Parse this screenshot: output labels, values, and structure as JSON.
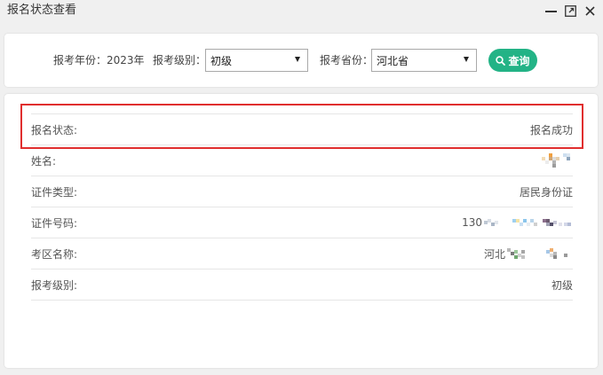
{
  "window": {
    "title": "报名状态查看",
    "controls": {
      "minimize_icon": "minimize-icon",
      "maximize_icon": "maximize-icon",
      "close_icon": "close-icon"
    }
  },
  "filter": {
    "year_label": "报考年份：",
    "year_value": "2023年",
    "level_label": "报考级别：",
    "level_selected": "初级",
    "province_label": "报考省份：",
    "province_selected": "河北省",
    "search_icon": "search-icon",
    "search_button_label": "查询"
  },
  "details": {
    "rows": [
      {
        "label": "报名状态:",
        "value": "报名成功",
        "highlighted": true
      },
      {
        "label": "姓名:",
        "redacted": true
      },
      {
        "label": "证件类型:",
        "value": "居民身份证"
      },
      {
        "label": "证件号码:",
        "value": "130",
        "redacted": true
      },
      {
        "label": "考区名称:",
        "value": "河北",
        "redacted": true
      },
      {
        "label": "报考级别:",
        "value": "初级"
      }
    ]
  },
  "colors": {
    "accent": "#23b386",
    "highlight_border": "#e02e2e"
  }
}
